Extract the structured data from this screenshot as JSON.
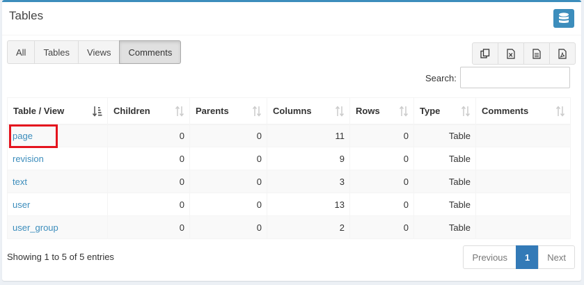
{
  "header": {
    "title": "Tables",
    "db_icon": "database-icon"
  },
  "filters": [
    {
      "label": "All"
    },
    {
      "label": "Tables"
    },
    {
      "label": "Views"
    },
    {
      "label": "Comments",
      "active": true
    }
  ],
  "export_buttons": [
    "copy-icon",
    "excel-icon",
    "csv-icon",
    "pdf-icon"
  ],
  "search": {
    "label": "Search:",
    "value": ""
  },
  "table": {
    "columns": [
      "Table / View",
      "Children",
      "Parents",
      "Columns",
      "Rows",
      "Type",
      "Comments"
    ],
    "rows": [
      {
        "name": "page",
        "children": "0",
        "parents": "0",
        "columns": "11",
        "rows": "0",
        "type": "Table",
        "comments": ""
      },
      {
        "name": "revision",
        "children": "0",
        "parents": "0",
        "columns": "9",
        "rows": "0",
        "type": "Table",
        "comments": ""
      },
      {
        "name": "text",
        "children": "0",
        "parents": "0",
        "columns": "3",
        "rows": "0",
        "type": "Table",
        "comments": ""
      },
      {
        "name": "user",
        "children": "0",
        "parents": "0",
        "columns": "13",
        "rows": "0",
        "type": "Table",
        "comments": ""
      },
      {
        "name": "user_group",
        "children": "0",
        "parents": "0",
        "columns": "2",
        "rows": "0",
        "type": "Table",
        "comments": ""
      }
    ]
  },
  "footer": {
    "info": "Showing 1 to 5 of 5 entries",
    "previous": "Previous",
    "current_page": "1",
    "next": "Next"
  },
  "colors": {
    "accent": "#3c8dbc",
    "highlight": "#e5141e",
    "page_active": "#337ab7"
  }
}
